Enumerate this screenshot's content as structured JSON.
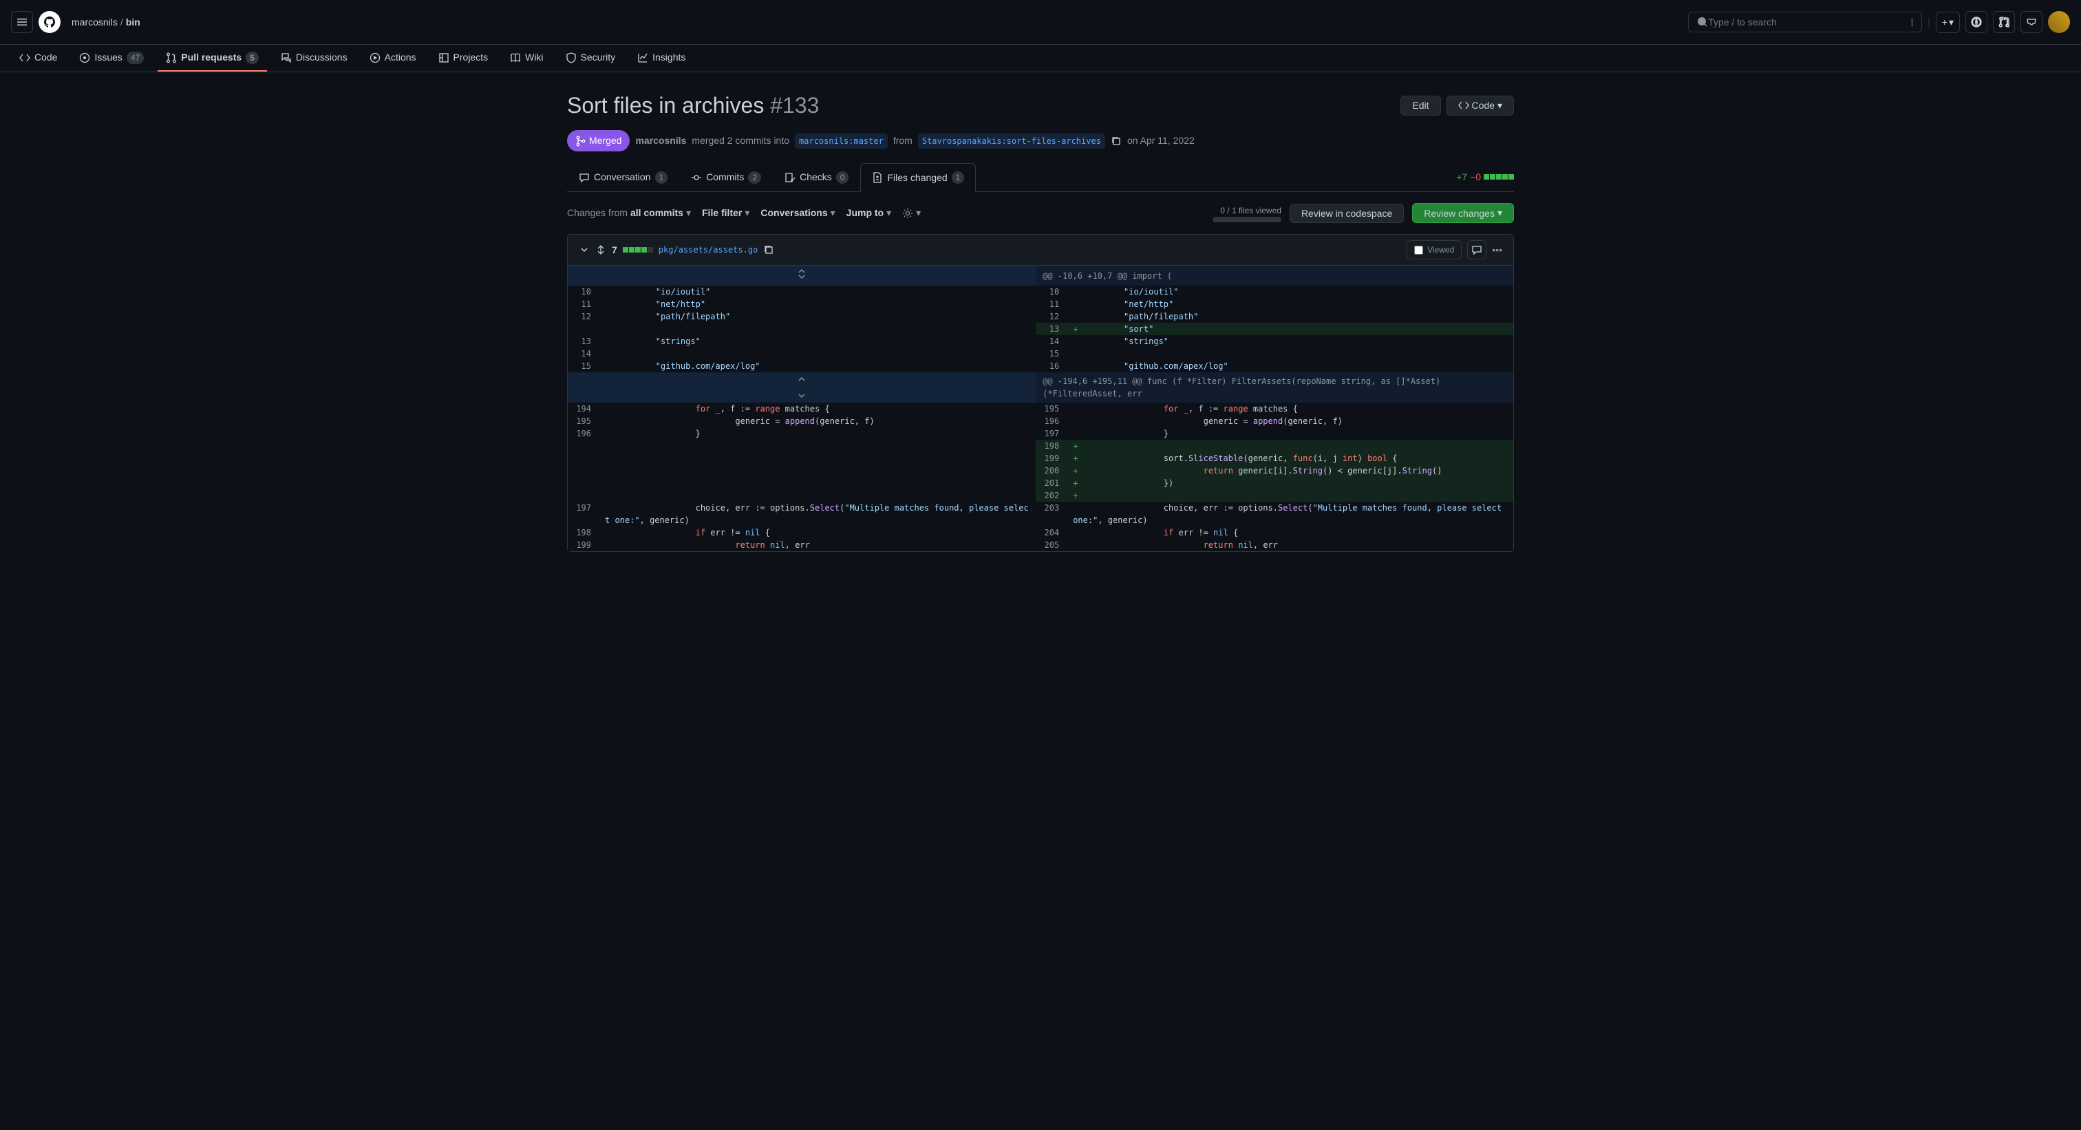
{
  "header": {
    "owner": "marcosnils",
    "repo": "bin",
    "search_placeholder": "Type / to search"
  },
  "repo_nav": {
    "code": "Code",
    "issues": "Issues",
    "issues_count": "47",
    "pull_requests": "Pull requests",
    "pr_count": "5",
    "discussions": "Discussions",
    "actions": "Actions",
    "projects": "Projects",
    "wiki": "Wiki",
    "security": "Security",
    "insights": "Insights"
  },
  "pr": {
    "title": "Sort files in archives",
    "number": "#133",
    "edit_btn": "Edit",
    "code_btn": "Code",
    "status": "Merged",
    "author": "marcosnils",
    "merge_line": "merged 2 commits into",
    "base_branch": "marcosnils:master",
    "from_word": "from",
    "head_branch": "Stavrospanakakis:sort-files-archives",
    "date": "on Apr 11, 2022"
  },
  "tabs": {
    "conversation": "Conversation",
    "conversation_count": "1",
    "commits": "Commits",
    "commits_count": "2",
    "checks": "Checks",
    "checks_count": "0",
    "files_changed": "Files changed",
    "files_count": "1",
    "additions": "+7",
    "deletions": "−0"
  },
  "toolbar": {
    "changes_from": "Changes from",
    "all_commits": "all commits",
    "file_filter": "File filter",
    "conversations": "Conversations",
    "jump_to": "Jump to",
    "viewed_label": "0 / 1 files viewed",
    "review_codespace": "Review in codespace",
    "review_changes": "Review changes"
  },
  "file": {
    "change_count": "7",
    "path": "pkg/assets/assets.go",
    "viewed_label": "Viewed"
  },
  "hunks": {
    "h1": "@@ -10,6 +10,7 @@ import (",
    "h2": "@@ -194,6 +195,11 @@ func (f *Filter) FilterAssets(repoName string, as []*Asset) (*FilteredAsset, err"
  },
  "lines": {
    "old": {
      "n10": "10",
      "n11": "11",
      "n12": "12",
      "n13": "13",
      "n14": "14",
      "n15": "15",
      "n194": "194",
      "n195": "195",
      "n196": "196",
      "n197": "197",
      "n198": "198",
      "n199": "199"
    },
    "new": {
      "n10": "10",
      "n11": "11",
      "n12": "12",
      "n13": "13",
      "n14": "14",
      "n15": "15",
      "n16": "16",
      "n195": "195",
      "n196": "196",
      "n197": "197",
      "n198": "198",
      "n199": "199",
      "n200": "200",
      "n201": "201",
      "n202": "202",
      "n203": "203",
      "n204": "204",
      "n205": "205"
    },
    "code": {
      "ioioutil": "\"io/ioutil\"",
      "nethttp": "\"net/http\"",
      "pathfilepath": "\"path/filepath\"",
      "sort": "\"sort\"",
      "strings": "\"strings\"",
      "apexlog": "\"github.com/apex/log\"",
      "for_matches": "for _, f := range matches {",
      "generic_append": "generic = append(generic, f)",
      "close_brace": "}",
      "sort_slice_a": "sort.",
      "sort_slice_b": "SliceStable",
      "sort_slice_c": "(generic, ",
      "sort_slice_d": "func",
      "sort_slice_e": "(i, j ",
      "sort_slice_f": "int",
      "sort_slice_g": ") ",
      "sort_slice_h": "bool",
      "sort_slice_i": " {",
      "return_cmp_a": "return",
      "return_cmp_b": " generic[i].",
      "return_cmp_c": "String",
      "return_cmp_d": "() < generic[j].",
      "return_cmp_e": "()",
      "close_paren": "})",
      "choice_a": "choice, err := options.",
      "choice_b": "Select",
      "choice_c": "(",
      "choice_d": "\"Multiple matches found, please select one:\"",
      "choice_e": ", generic)",
      "if_err_a": "if err != ",
      "if_err_b": "nil",
      "if_err_c": " {",
      "return_nil_a": "return ",
      "return_nil_b": "nil",
      "return_nil_c": ", err"
    }
  }
}
